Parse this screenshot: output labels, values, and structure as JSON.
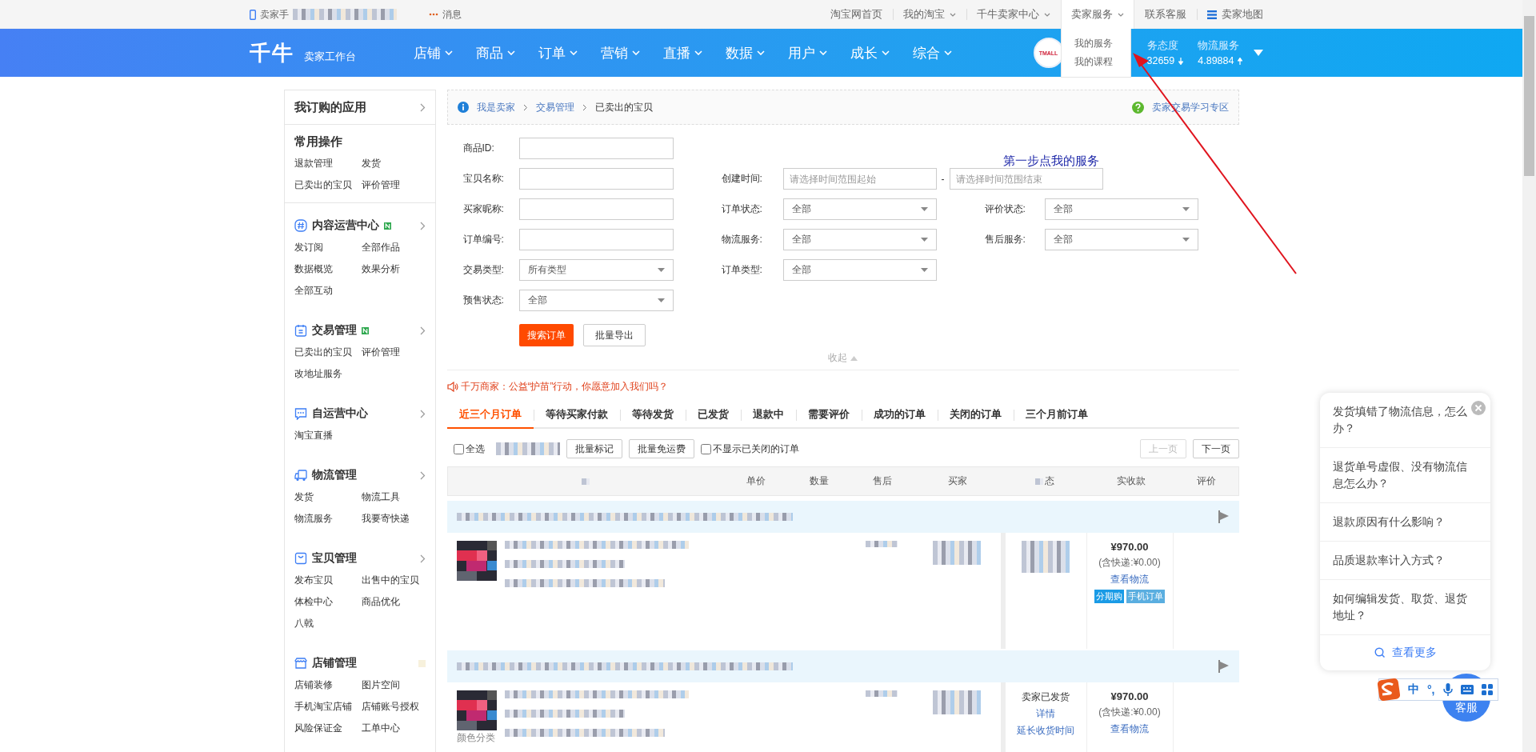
{
  "top_bar": {
    "left": [
      {
        "kind": "phone",
        "label": "卖家手"
      },
      {
        "kind": "message",
        "label": "消息"
      }
    ],
    "right": [
      {
        "label": "淘宝网首页",
        "kind": "link",
        "open": false
      },
      {
        "label": "我的淘宝",
        "kind": "dropdown",
        "open": false
      },
      {
        "label": "千牛卖家中心",
        "kind": "dropdown",
        "open": false
      },
      {
        "label": "卖家服务",
        "kind": "dropdown",
        "open": true
      },
      {
        "label": "联系客服",
        "kind": "link",
        "open": false
      },
      {
        "label": "卖家地图",
        "kind": "map",
        "open": false
      }
    ],
    "open_menu": [
      "我的服务",
      "我的课程"
    ]
  },
  "header": {
    "logo": "千牛",
    "subtitle": "卖家工作台",
    "nav": [
      "店铺",
      "商品",
      "订单",
      "营销",
      "直播",
      "数据",
      "用户",
      "成长",
      "综合"
    ],
    "badge": "TMALL",
    "scores": [
      {
        "label": "务态度",
        "value": "32659",
        "kind": "down"
      },
      {
        "label": "物流服务",
        "value": "4.89884",
        "kind": "up"
      }
    ]
  },
  "sidebar": {
    "title": "我订购的应用",
    "common": {
      "title": "常用操作",
      "links": [
        "退款管理",
        "发货",
        "已卖出的宝贝",
        "评价管理"
      ]
    },
    "groups": [
      {
        "kind": "hash",
        "title": "内容运营中心",
        "new": true,
        "chevron": true,
        "links": [
          "发订阅",
          "全部作品",
          "数据概览",
          "效果分析",
          "全部互动"
        ]
      },
      {
        "kind": "calendar",
        "title": "交易管理",
        "new": true,
        "chevron": true,
        "links": [
          "已卖出的宝贝",
          "评价管理",
          "改地址服务"
        ]
      },
      {
        "kind": "chat",
        "title": "自运营中心",
        "new": false,
        "chevron": true,
        "links": [
          "淘宝直播"
        ]
      },
      {
        "kind": "truck",
        "title": "物流管理",
        "new": false,
        "chevron": true,
        "links": [
          "发货",
          "物流工具",
          "物流服务",
          "我要寄快递"
        ]
      },
      {
        "kind": "bag",
        "title": "宝贝管理",
        "new": false,
        "chevron": true,
        "links": [
          "发布宝贝",
          "出售中的宝贝",
          "体检中心",
          "商品优化",
          "八戟"
        ]
      },
      {
        "kind": "shop",
        "title": "店铺管理",
        "new": false,
        "chevron": false,
        "links": [
          "店铺装修",
          "图片空间",
          "手机淘宝店铺",
          "店铺账号授权",
          "风险保证金",
          "工单中心"
        ]
      }
    ]
  },
  "breadcrumb": {
    "items": [
      "我是卖家",
      "交易管理"
    ],
    "current": "已卖出的宝贝",
    "help": "卖家交易学习专区"
  },
  "annotation": "第一步点我的服务",
  "form": {
    "rows": [
      {
        "left": {
          "label": "商品ID:",
          "kind": "text"
        }
      },
      {
        "left": {
          "label": "宝贝名称:",
          "kind": "text"
        },
        "middle": {
          "label": "创建时间:",
          "kind": "range",
          "inputs": [
            {
              "placeholder": "请选择时间范围起始"
            },
            {
              "placeholder": "请选择时间范围结束"
            }
          ],
          "separator": "-"
        }
      },
      {
        "left": {
          "label": "买家昵称:",
          "kind": "text"
        },
        "middle": {
          "label": "订单状态:",
          "kind": "select",
          "value": "全部"
        },
        "right": {
          "label": "评价状态:",
          "kind": "select",
          "value": "全部"
        }
      },
      {
        "left": {
          "label": "订单编号:",
          "kind": "text"
        },
        "middle": {
          "label": "物流服务:",
          "kind": "select",
          "value": "全部"
        },
        "right": {
          "label": "售后服务:",
          "kind": "select",
          "value": "全部"
        }
      },
      {
        "left": {
          "label": "交易类型:",
          "kind": "select",
          "value": "所有类型"
        },
        "middle": {
          "label": "订单类型:",
          "kind": "select",
          "value": "全部"
        }
      },
      {
        "left": {
          "label": "预售状态:",
          "kind": "select",
          "value": "全部"
        }
      }
    ],
    "search": "搜索订单",
    "export": "批量导出",
    "collapse": "收起"
  },
  "notice": "千万商家：公益“护苗”行动，你愿意加入我们吗？",
  "tabs": [
    {
      "label": "近三个月订单",
      "selected": true
    },
    {
      "label": "等待买家付款",
      "selected": false
    },
    {
      "label": "等待发货",
      "selected": false
    },
    {
      "label": "已发货",
      "selected": false
    },
    {
      "label": "退款中",
      "selected": false
    },
    {
      "label": "需要评价",
      "selected": false
    },
    {
      "label": "成功的订单",
      "selected": false
    },
    {
      "label": "关闭的订单",
      "selected": false
    },
    {
      "label": "三个月前订单",
      "selected": false
    }
  ],
  "toolbar": {
    "select_all": {
      "label": "全选",
      "checked": false
    },
    "buttons": [
      "批量标记",
      "批量免运费"
    ],
    "hide_closed": {
      "label": "不显示已关闭的订单",
      "checked": false
    },
    "pager": [
      {
        "label": "上一页",
        "disabled": true
      },
      {
        "label": "下一页",
        "disabled": false
      }
    ]
  },
  "table": {
    "columns": [
      "单价",
      "数量",
      "售后",
      "买家",
      "态",
      "实收款",
      "评价"
    ],
    "orders": [
      {
        "price": "¥970.00",
        "shipping": "(含快递:¥0.00)",
        "link": "查看物流",
        "tags": [
          {
            "label": "分期购",
            "color": "#1a9be6"
          },
          {
            "label": "手机订单",
            "color": "#5aaee0"
          }
        ]
      },
      {
        "sku_label": "颜色分类",
        "status": [
          {
            "kind": "text",
            "label": "卖家已发货"
          },
          {
            "kind": "link",
            "label": "详情"
          },
          {
            "kind": "link",
            "label": "延长收货时间"
          }
        ],
        "price": "¥970.00",
        "shipping": "(含快递:¥0.00)",
        "link": "查看物流"
      }
    ]
  },
  "help_panel": {
    "questions": [
      "发货填错了物流信息，怎么办？",
      "退货单号虚假、没有物流信息怎么办？",
      "退款原因有什么影响？",
      "品质退款率计入方式？",
      "如何编辑发货、取货、退货地址？"
    ],
    "more": "查看更多"
  },
  "service_button": "客服",
  "ime": {
    "mode": "中",
    "punct": "°,"
  }
}
